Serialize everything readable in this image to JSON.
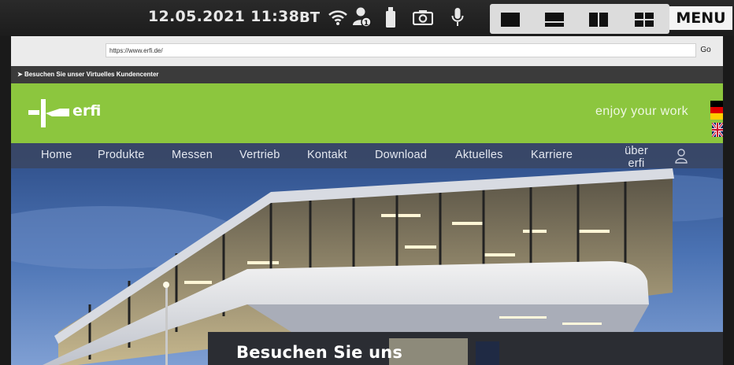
{
  "statusbar": {
    "datetime": "12.05.2021 11:38",
    "bt_label": "BT",
    "icons": [
      "wifi-icon",
      "user-notification-icon",
      "usb-stick-icon",
      "camera-icon",
      "microphone-icon"
    ],
    "layouts": [
      "layout-single-icon",
      "layout-two-rows-icon",
      "layout-two-columns-icon",
      "layout-grid-icon"
    ],
    "menu_label": "MENU"
  },
  "browser": {
    "url": "https://www.erfi.de/",
    "go_label": "Go"
  },
  "site": {
    "info_text": "Besuchen Sie unser Virtuelles Kundencenter",
    "logo_text": "erfi",
    "slogan": "enjoy your work",
    "nav": [
      "Home",
      "Produkte",
      "Messen",
      "Vertrieb",
      "Kontakt",
      "Download",
      "Aktuelles",
      "Karriere",
      "über erfi"
    ],
    "hero_title": "Besuchen Sie uns"
  },
  "colors": {
    "brand_green": "#8cc63e",
    "nav_bg": "#3a4660",
    "status_bg": "#1c1c1c"
  }
}
